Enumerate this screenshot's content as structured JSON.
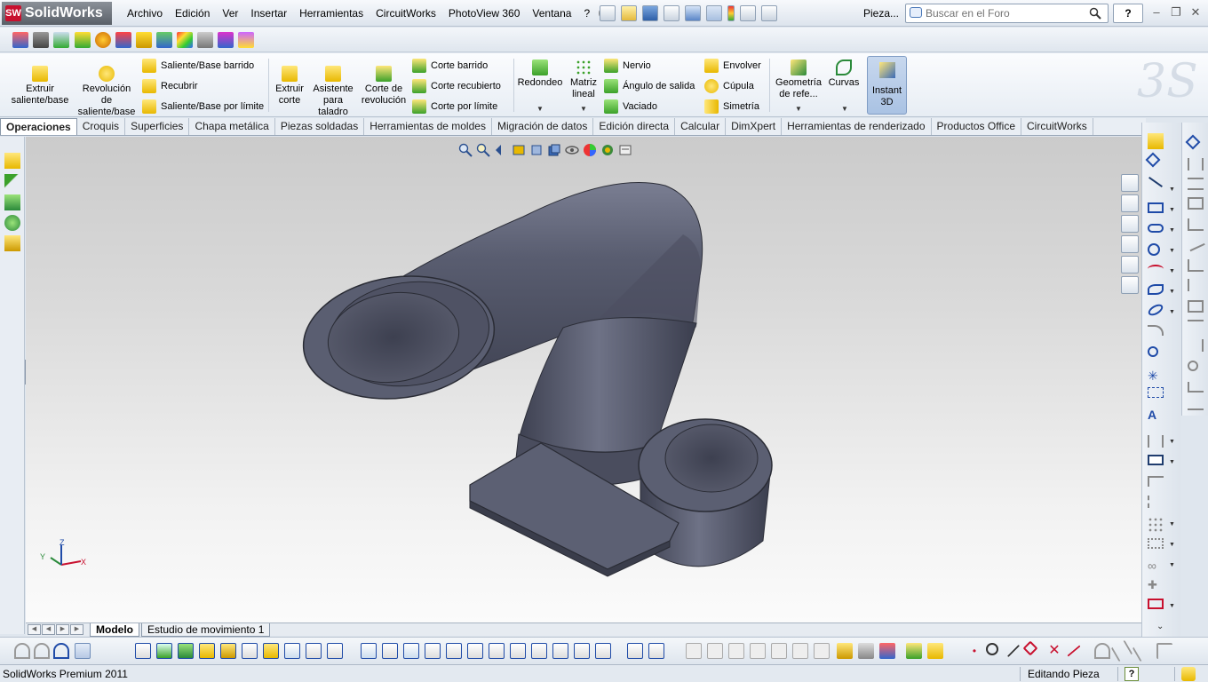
{
  "app": {
    "brand": "SolidWorks",
    "brand_mark": "SW",
    "menus": [
      "Archivo",
      "Edición",
      "Ver",
      "Insertar",
      "Herramientas",
      "CircuitWorks",
      "PhotoView 360",
      "Ventana",
      "?"
    ],
    "document_name": "Pieza...",
    "search": {
      "placeholder": "Buscar en el Foro"
    },
    "help_label": "?"
  },
  "ribbon": {
    "large_buttons": [
      {
        "label_1": "Extruir",
        "label_2": "saliente/base",
        "label_3": "",
        "icon": "extrude-boss-icon",
        "color": "#e8b800"
      },
      {
        "label_1": "Revolución",
        "label_2": "de",
        "label_3": "saliente/base",
        "icon": "revolve-boss-icon",
        "color": "#e8b800"
      },
      {
        "label_1": "Extruir",
        "label_2": "corte",
        "label_3": "",
        "icon": "extrude-cut-icon",
        "color": "#e8b800"
      },
      {
        "label_1": "Asistente",
        "label_2": "para",
        "label_3": "taladro",
        "icon": "hole-wizard-icon",
        "color": "#e8b800"
      },
      {
        "label_1": "Corte de",
        "label_2": "revolución",
        "label_3": "",
        "icon": "revolve-cut-icon",
        "color": "#e8b800"
      },
      {
        "label_1": "Redondeo",
        "label_2": "",
        "label_3": "",
        "icon": "fillet-icon",
        "color": "#3ba12a"
      },
      {
        "label_1": "Matriz",
        "label_2": "lineal",
        "label_3": "",
        "icon": "linear-pattern-icon",
        "color": "#3ba12a"
      },
      {
        "label_1": "Geometría",
        "label_2": "de refe...",
        "label_3": "",
        "icon": "reference-geometry-icon",
        "color": "#2a8a3a"
      },
      {
        "label_1": "Curvas",
        "label_2": "",
        "label_3": "",
        "icon": "curves-icon",
        "color": "#2a8a3a"
      }
    ],
    "small_buttons": [
      {
        "label": "Saliente/Base barrido",
        "icon": "swept-boss-icon",
        "color": "#e8b800"
      },
      {
        "label": "Recubrir",
        "icon": "loft-icon",
        "color": "#e8b800"
      },
      {
        "label": "Saliente/Base por límite",
        "icon": "boundary-boss-icon",
        "color": "#e8b800"
      },
      {
        "label": "Corte barrido",
        "icon": "swept-cut-icon",
        "color": "#e8b800"
      },
      {
        "label": "Corte recubierto",
        "icon": "lofted-cut-icon",
        "color": "#e8b800"
      },
      {
        "label": "Corte por límite",
        "icon": "boundary-cut-icon",
        "color": "#e8b800"
      },
      {
        "label": "Nervio",
        "icon": "rib-icon",
        "color": "#3ba12a"
      },
      {
        "label": "Ángulo de salida",
        "icon": "draft-icon",
        "color": "#3ba12a"
      },
      {
        "label": "Vaciado",
        "icon": "shell-icon",
        "color": "#3ba12a"
      },
      {
        "label": "Envolver",
        "icon": "wrap-icon",
        "color": "#e8b800"
      },
      {
        "label": "Cúpula",
        "icon": "dome-icon",
        "color": "#e8b800"
      },
      {
        "label": "Simetría",
        "icon": "mirror-icon",
        "color": "#e8b800"
      }
    ],
    "instant3d": {
      "label_1": "Instant",
      "label_2": "3D"
    }
  },
  "tabs": [
    "Operaciones",
    "Croquis",
    "Superficies",
    "Chapa metálica",
    "Piezas soldadas",
    "Herramientas de moldes",
    "Migración de datos",
    "Edición directa",
    "Calcular",
    "DimXpert",
    "Herramientas de renderizado",
    "Productos Office",
    "CircuitWorks"
  ],
  "viewport": {
    "model_color": "#4a4d5c",
    "triad": {
      "x": "X",
      "y": "Y",
      "z": "Z"
    }
  },
  "bottom_tabs": {
    "model": "Modelo",
    "motion": "Estudio de movimiento 1"
  },
  "status": {
    "product": "SolidWorks Premium 2011",
    "mode": "Editando Pieza",
    "help": "?"
  }
}
